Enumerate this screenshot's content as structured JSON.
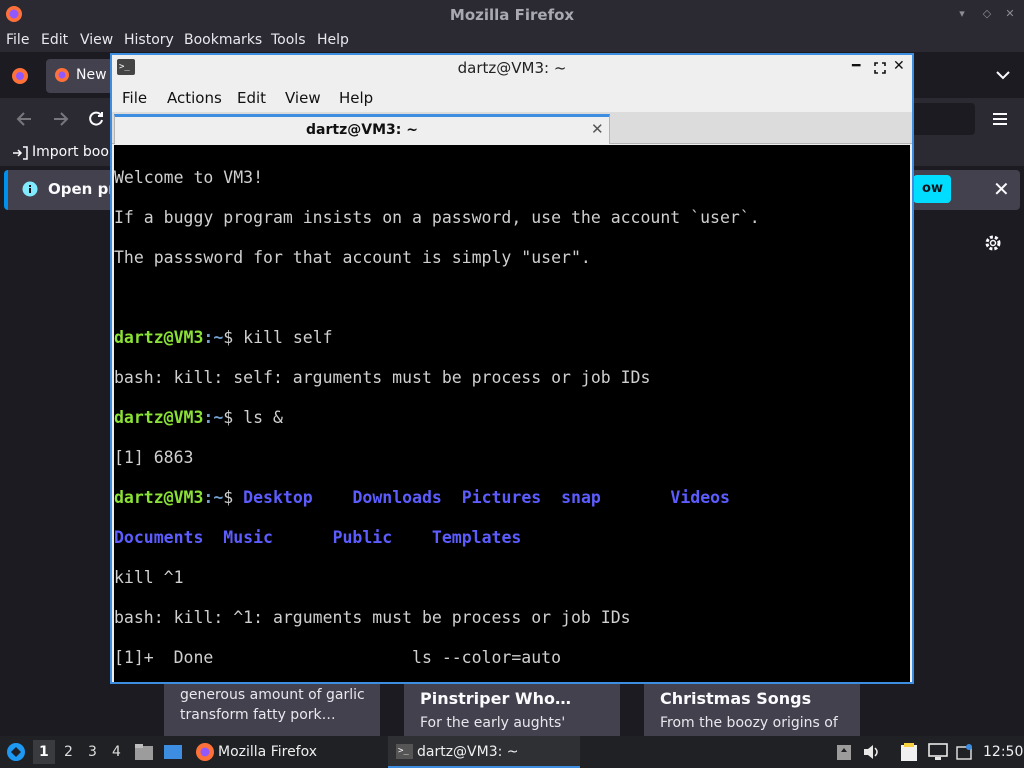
{
  "firefox": {
    "window_title": "Mozilla Firefox",
    "menu": [
      "File",
      "Edit",
      "View",
      "History",
      "Bookmarks",
      "Tools",
      "Help"
    ],
    "tab_label": "New",
    "bookmarks_label": "Import book",
    "notice_text": "Open pre",
    "notice_button": "ow",
    "cards": [
      {
        "head": "",
        "line1": "generous amount of garlic",
        "line2": "transform fatty pork…"
      },
      {
        "head": "Pinstriper Who…",
        "line1": "For the early aughts'",
        "line2": ""
      },
      {
        "head": "Christmas Songs",
        "line1": "From the boozy origins of",
        "line2": ""
      }
    ]
  },
  "terminal": {
    "window_title": "dartz@VM3: ~",
    "menu": [
      "File",
      "Actions",
      "Edit",
      "View",
      "Help"
    ],
    "tab_title": "dartz@VM3: ~",
    "prompt_user": "dartz@VM3",
    "prompt_path": ":~",
    "prompt_symbol": "$ ",
    "lines": {
      "l1": "Welcome to VM3!",
      "l2": "If a buggy program insists on a password, use the account `user`.",
      "l3": "The passsword for that account is simply \"user\".",
      "cmd1": "kill self",
      "out1": "bash: kill: self: arguments must be process or job IDs",
      "cmd2": "ls &",
      "out2": "[1] 6863",
      "dirs_row1": [
        "Desktop",
        "Downloads",
        "Pictures",
        "snap",
        "Videos"
      ],
      "dirs_row2": [
        "Documents",
        "Music",
        "Public",
        "Templates"
      ],
      "typed": "kill ^1",
      "out3": "bash: kill: ^1: arguments must be process or job IDs",
      "out4": "[1]+  Done                    ls --color=auto"
    }
  },
  "taskbar": {
    "workspaces": [
      "1",
      "2",
      "3",
      "4"
    ],
    "tasks": [
      "Mozilla Firefox",
      "dartz@VM3: ~"
    ],
    "clock": "12:50"
  }
}
